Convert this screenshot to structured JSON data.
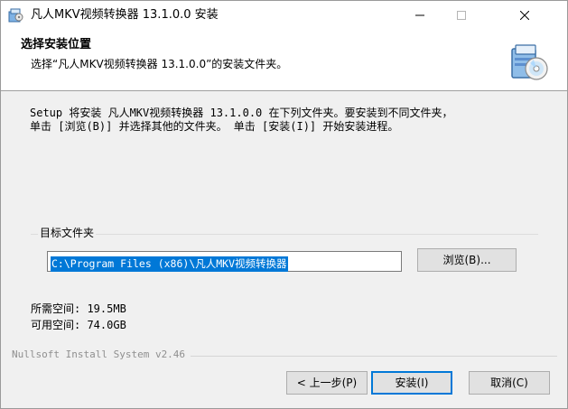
{
  "window": {
    "title": "凡人MKV视频转换器 13.1.0.0 安装",
    "icon": "installer-package-icon"
  },
  "header": {
    "title": "选择安装位置",
    "subtitle": "选择“凡人MKV视频转换器 13.1.0.0”的安装文件夹。",
    "icon": "cd-installer-icon"
  },
  "description": "Setup 将安装 凡人MKV视频转换器 13.1.0.0 在下列文件夹。要安装到不同文件夹，\n单击 [浏览(B)] 并选择其他的文件夹。 单击 [安装(I)] 开始安装进程。",
  "destination": {
    "group_label": "目标文件夹",
    "path_value": "C:\\Program Files (x86)\\凡人MKV视频转换器",
    "browse_label": "浏览(B)..."
  },
  "space": {
    "required": "所需空间: 19.5MB",
    "available": "可用空间: 74.0GB"
  },
  "branding": "Nullsoft Install System v2.46",
  "buttons": {
    "back": "< 上一步(P)",
    "install": "安装(I)",
    "cancel": "取消(C)"
  },
  "colors": {
    "selection": "#0078d7",
    "header_bg": "#ffffff",
    "dialog_bg": "#f0f0f0"
  }
}
